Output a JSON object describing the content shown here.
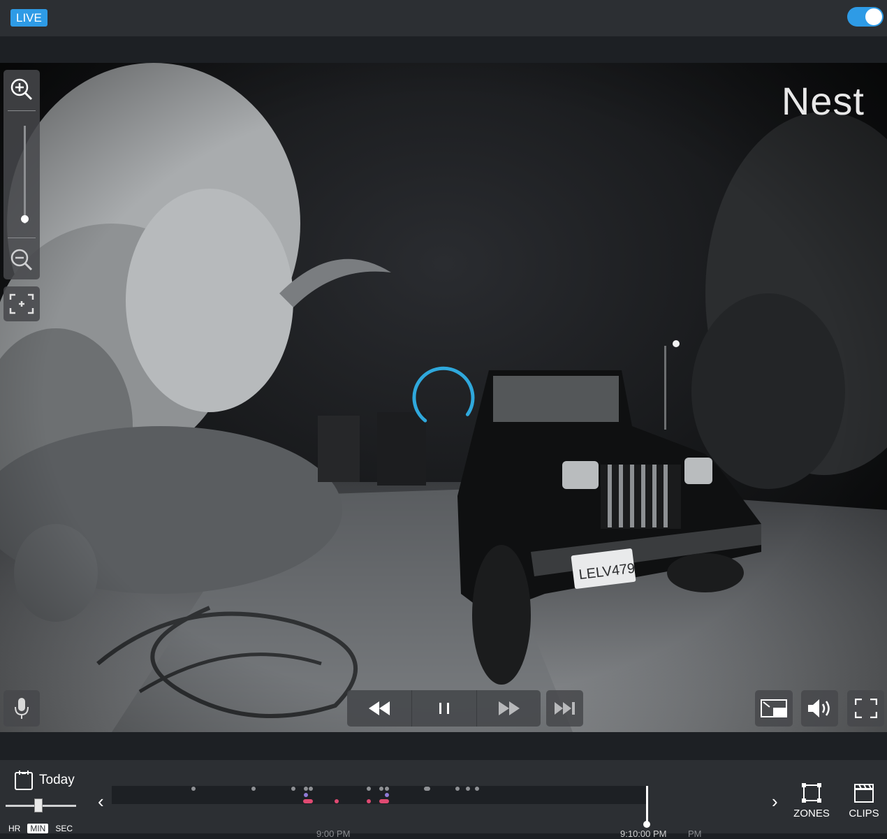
{
  "header": {
    "live_label": "LIVE",
    "live_toggle_on": true
  },
  "video": {
    "watermark": "Nest",
    "license_plate": "LELV479",
    "loading": true
  },
  "controls": {
    "zoom_in_icon": "zoom-in-icon",
    "zoom_out_icon": "zoom-out-icon",
    "zoom_level": 0,
    "enhance_icon": "enhance-icon",
    "mic_icon": "microphone-icon",
    "rewind_icon": "rewind-icon",
    "pause_icon": "pause-icon",
    "forward_icon": "fast-forward-icon",
    "skip_icon": "skip-to-live-icon",
    "pip_icon": "picture-in-picture-icon",
    "volume_icon": "volume-icon",
    "fullscreen_icon": "fullscreen-icon"
  },
  "timeline": {
    "date_label": "Today",
    "scale_labels": [
      "HR",
      "MIN",
      "SEC"
    ],
    "selected_scale": "MIN",
    "prev_arrow": "‹",
    "next_arrow": "›",
    "time_labels": [
      "9:00 PM",
      "9:10:00 PM",
      "PM"
    ]
  },
  "side_buttons": {
    "zones_label": "ZONES",
    "clips_label": "CLIPS"
  },
  "colors": {
    "accent": "#2e9be6",
    "bar": "#2c2f33",
    "event_gray": "#8e9094",
    "event_purple": "#8f7ad6",
    "event_pink": "#e04a72"
  }
}
